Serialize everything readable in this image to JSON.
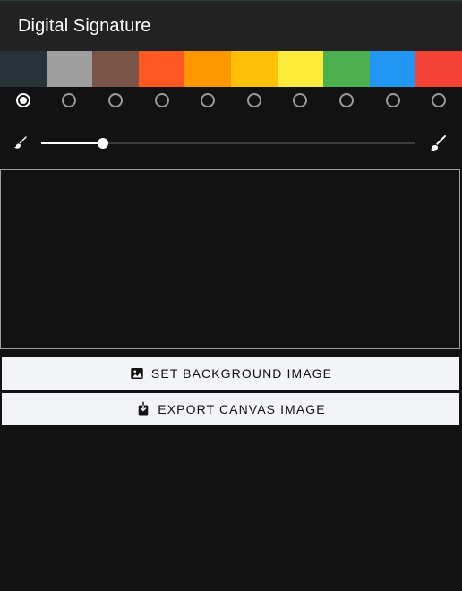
{
  "header": {
    "title": "Digital Signature"
  },
  "palette": {
    "colors": [
      "#263238",
      "#9e9e9e",
      "#795548",
      "#ff5722",
      "#ff9800",
      "#ffc107",
      "#ffeb3b",
      "#4caf50",
      "#2196f3",
      "#f44336"
    ],
    "selected_index": 0
  },
  "brush_size": {
    "value": 0.165
  },
  "buttons": {
    "set_background": "SET BACKGROUND IMAGE",
    "export_canvas": "EXPORT CANVAS IMAGE"
  },
  "icons": {
    "brush_small": "brush-icon",
    "brush_large": "brush-icon",
    "set_background": "image-icon",
    "export_canvas": "download-icon"
  }
}
